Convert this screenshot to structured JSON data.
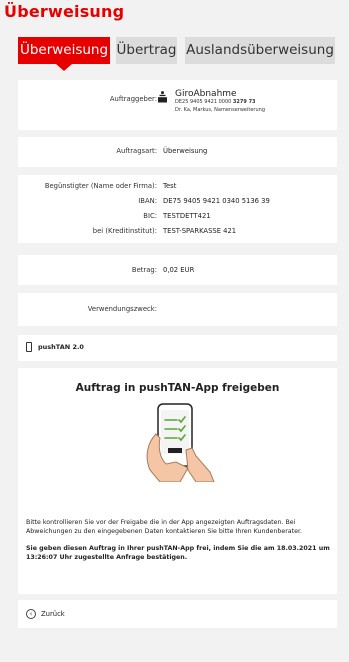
{
  "header": {
    "title": "Überweisung"
  },
  "tabs": [
    {
      "label": "Überweisung",
      "active": true
    },
    {
      "label": "Übertrag",
      "active": false
    },
    {
      "label": "Auslandsüberweisung",
      "active": false
    }
  ],
  "colors": {
    "accent": "#e60000",
    "tab_inactive": "#dcdcdc",
    "background": "#f2f2f2"
  },
  "principal": {
    "label": "Auftraggeber:",
    "account_name": "GiroAbnahme",
    "iban_prefix": "DE25 9405 9421 0000",
    "iban_suffix": "3279 73",
    "owner": "Dr. Ka, Markus, Namenserweiterung",
    "icon": "sparkasse-logo"
  },
  "order_type": {
    "label": "Auftragsart:",
    "value": "Überweisung"
  },
  "beneficiary": {
    "name_label": "Begünstigter (Name oder Firma):",
    "name_value": "Test",
    "iban_label": "IBAN:",
    "iban_value": "DE75 9405 9421 0340 5136 39",
    "bic_label": "BIC:",
    "bic_value": "TESTDETT421",
    "bank_label": "bei (Kreditinstitut):",
    "bank_value": "TEST-SPARKASSE 421"
  },
  "amount": {
    "label": "Betrag:",
    "value": "0,02 EUR"
  },
  "purpose": {
    "label": "Verwendungszweck:",
    "value": ""
  },
  "pushtan": {
    "label": "pushTAN 2.0",
    "icon": "smartphone-icon"
  },
  "approval": {
    "title": "Auftrag in pushTAN-App freigeben",
    "instruction": "Bitte kontrollieren Sie vor der Freigabe die in der App angezeigten Auftragsdaten. Bei Abweichungen zu den eingegebenen Daten kontaktieren Sie bitte Ihren Kundenberater.",
    "confirm": "Sie geben diesen Auftrag in Ihrer pushTAN-App frei, indem Sie die am 18.03.2021 um 13:26:07 Uhr zugestellte Anfrage bestätigen.",
    "illustration": "hand-holding-phone-illustration"
  },
  "back": {
    "label": "Zurück",
    "icon": "chevron-left-circle-icon"
  }
}
